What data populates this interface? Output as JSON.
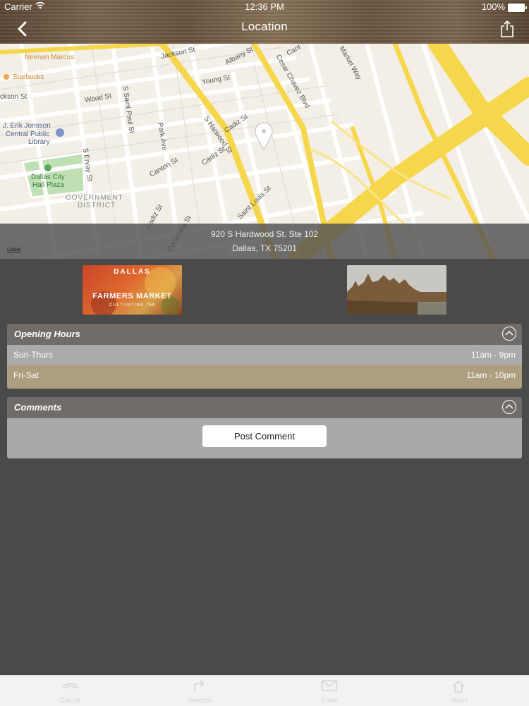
{
  "status_bar": {
    "carrier": "Carrier",
    "time": "12:36 PM",
    "battery": "100%"
  },
  "nav": {
    "title": "Location"
  },
  "map": {
    "labels": {
      "neiman": "Neiman Marcus",
      "starbucks": "Starbucks",
      "jackson_w": "ckson St",
      "jackson_n": "Jackson St",
      "albany": "Albany St",
      "young": "Young St",
      "wood": "Wood St",
      "st_paul": "S Saint Paul St",
      "library1": "J. Erik Jonsson",
      "library2": "Central Public",
      "library3": "Library",
      "ervay": "S Ervay St",
      "park": "Park Ave",
      "canton": "Canton St",
      "harwood": "S Harwood St",
      "cadiz1": "Cadiz St",
      "cadiz2": "Cadiz St",
      "cadiz3": "Cadiz St",
      "cesar": "Cesar Chavez Blvd",
      "market": "Market Way",
      "plaza1": "Dallas City",
      "plaza2": "Hall Plaza",
      "gov1": "GOVERNMENT",
      "gov2": "DISTRICT",
      "corsicana": "Corsicana St",
      "saint_louis": "Saint Louis St",
      "cant": "Cant"
    },
    "address_line1": "920 S Hardwood St. Ste 102",
    "address_line2": "Dallas, TX 75201",
    "legal": "Legal"
  },
  "thumbnails": {
    "left": {
      "top": "DALLAS",
      "main": "FARMERS MARKET",
      "sub": "CULTIVATING 75¢"
    }
  },
  "opening_hours": {
    "title": "Opening Hours",
    "rows": [
      {
        "days": "Sun-Thurs",
        "hours": "11am - 9pm"
      },
      {
        "days": "Fri-Sat",
        "hours": "11am - 10pm"
      }
    ]
  },
  "comments": {
    "title": "Comments",
    "post_button": "Post Comment"
  },
  "tabs": [
    {
      "label": "Call Us",
      "icon": "phone-icon"
    },
    {
      "label": "Direction",
      "icon": "direction-icon"
    },
    {
      "label": "Email",
      "icon": "email-icon"
    },
    {
      "label": "Home",
      "icon": "home-icon"
    }
  ]
}
